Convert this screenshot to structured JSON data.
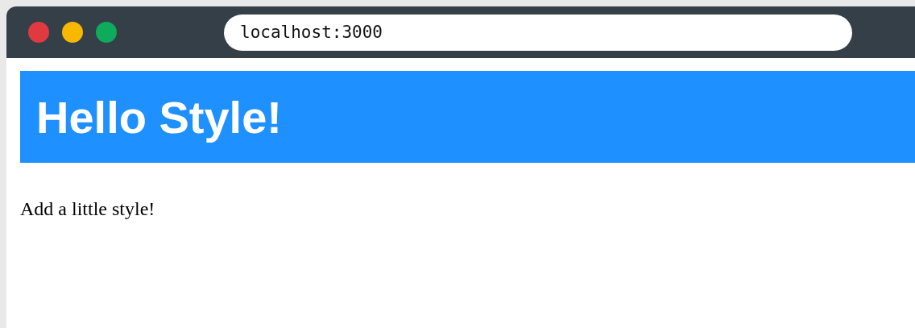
{
  "browser": {
    "address": "localhost:3000"
  },
  "page": {
    "heading": "Hello Style!",
    "paragraph": "Add a little style!"
  }
}
